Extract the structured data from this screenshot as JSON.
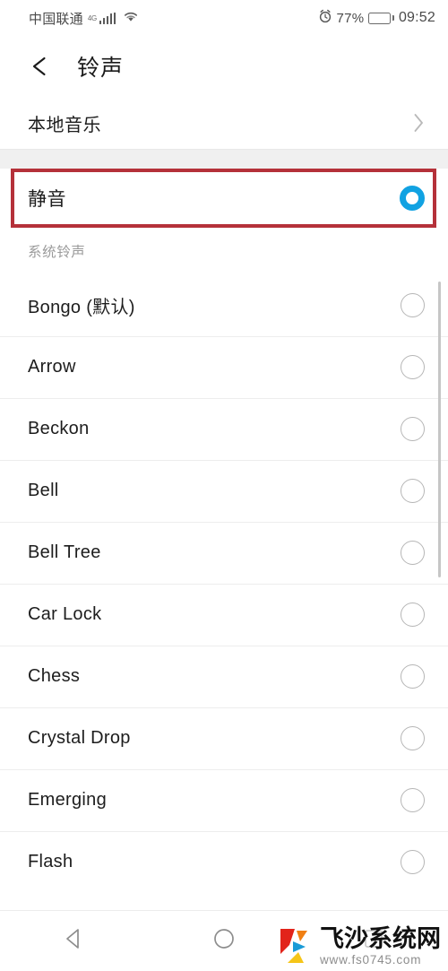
{
  "statusbar": {
    "carrier": "中国联通",
    "network": "4G",
    "signal_icon": "signal-bars-icon",
    "wifi_icon": "wifi-icon",
    "alarm_icon": "alarm-clock-icon",
    "battery_percent": "77%",
    "battery_icon": "battery-icon",
    "time": "09:52"
  },
  "header": {
    "back_icon": "back-arrow-icon",
    "title": "铃声"
  },
  "local_music": {
    "label": "本地音乐",
    "chevron_icon": "chevron-right-icon"
  },
  "silent": {
    "label": "静音",
    "selected": true,
    "highlight_color": "#b5313a",
    "radio_color": "#11a2e2"
  },
  "section": {
    "title": "系统铃声"
  },
  "ringtones": [
    {
      "label": "Bongo (默认)",
      "selected": false
    },
    {
      "label": "Arrow",
      "selected": false
    },
    {
      "label": "Beckon",
      "selected": false
    },
    {
      "label": "Bell",
      "selected": false
    },
    {
      "label": "Bell Tree",
      "selected": false
    },
    {
      "label": "Car Lock",
      "selected": false
    },
    {
      "label": "Chess",
      "selected": false
    },
    {
      "label": "Crystal Drop",
      "selected": false
    },
    {
      "label": "Emerging",
      "selected": false
    },
    {
      "label": "Flash",
      "selected": false
    }
  ],
  "navbar": {
    "back_icon": "nav-back-triangle-icon",
    "home_icon": "nav-home-circle-icon",
    "recents_icon": "nav-recents-icon"
  },
  "watermark": {
    "logo_icon": "feisha-logo-icon",
    "name": "飞沙系统网",
    "url": "www.fs0745.com"
  }
}
